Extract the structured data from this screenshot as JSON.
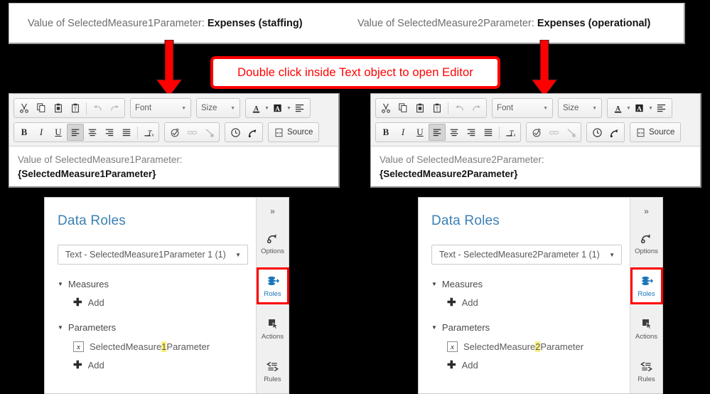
{
  "top_bar": {
    "left": {
      "label": "Value of SelectedMeasure1Parameter:",
      "value": "Expenses (staffing)"
    },
    "right": {
      "label": "Value of SelectedMeasure2Parameter:",
      "value": "Expenses (operational)"
    }
  },
  "callout": {
    "text": "Double click inside Text object to open Editor"
  },
  "editors": [
    {
      "id": "editor-1",
      "toolbar": {
        "cut": "cut-icon",
        "copy": "copy-icon",
        "paste": "paste-icon",
        "paste_text": "paste-as-text-icon",
        "undo": "undo-icon",
        "redo": "redo-icon",
        "font_label": "Font",
        "size_label": "Size",
        "text_color": "text-color-icon",
        "bg_color": "background-color-icon",
        "paragraph_format": "paragraph-format-icon",
        "bold": "B",
        "italic": "I",
        "underline": "U",
        "align_left": "align-left-icon",
        "align_center": "align-center-icon",
        "align_right": "align-right-icon",
        "align_justify": "align-justify-icon",
        "remove_format": "remove-format-icon",
        "spellcheck": "spellcheck-icon",
        "link": "link-icon",
        "unlink": "unlink-icon",
        "datetime": "datetime-icon",
        "branch": "data-item-icon",
        "source_label": "Source"
      },
      "content": {
        "line1": "Value of SelectedMeasure1Parameter:",
        "line2": "{SelectedMeasure1Parameter}"
      }
    },
    {
      "id": "editor-2",
      "toolbar": {
        "cut": "cut-icon",
        "copy": "copy-icon",
        "paste": "paste-icon",
        "paste_text": "paste-as-text-icon",
        "undo": "undo-icon",
        "redo": "redo-icon",
        "font_label": "Font",
        "size_label": "Size",
        "text_color": "text-color-icon",
        "bg_color": "background-color-icon",
        "paragraph_format": "paragraph-format-icon",
        "bold": "B",
        "italic": "I",
        "underline": "U",
        "align_left": "align-left-icon",
        "align_center": "align-center-icon",
        "align_right": "align-right-icon",
        "align_justify": "align-justify-icon",
        "remove_format": "remove-format-icon",
        "spellcheck": "spellcheck-icon",
        "link": "link-icon",
        "unlink": "unlink-icon",
        "datetime": "datetime-icon",
        "branch": "data-item-icon",
        "source_label": "Source"
      },
      "content": {
        "line1": "Value of SelectedMeasure2Parameter:",
        "line2": "{SelectedMeasure2Parameter}"
      }
    }
  ],
  "panels": [
    {
      "id": "panel-1",
      "title": "Data Roles",
      "select_value": "Text - SelectedMeasure1Parameter 1 (1)",
      "groups": [
        {
          "label": "Measures",
          "add_label": "Add"
        },
        {
          "label": "Parameters",
          "add_label": "Add"
        }
      ],
      "parameter": {
        "prefix": "SelectedMeasure",
        "highlight": "1",
        "suffix": "Parameter"
      },
      "rail": {
        "expand": "»",
        "items": [
          {
            "label": "Options",
            "icon": "options-icon",
            "active": false
          },
          {
            "label": "Roles",
            "icon": "roles-icon",
            "active": true
          },
          {
            "label": "Actions",
            "icon": "actions-icon",
            "active": false
          },
          {
            "label": "Rules",
            "icon": "rules-icon",
            "active": false
          }
        ]
      }
    },
    {
      "id": "panel-2",
      "title": "Data Roles",
      "select_value": "Text - SelectedMeasure2Parameter 1 (1)",
      "groups": [
        {
          "label": "Measures",
          "add_label": "Add"
        },
        {
          "label": "Parameters",
          "add_label": "Add"
        }
      ],
      "parameter": {
        "prefix": "SelectedMeasure",
        "highlight": "2",
        "suffix": "Parameter"
      },
      "rail": {
        "expand": "»",
        "items": [
          {
            "label": "Options",
            "icon": "options-icon",
            "active": false
          },
          {
            "label": "Roles",
            "icon": "roles-icon",
            "active": true
          },
          {
            "label": "Actions",
            "icon": "actions-icon",
            "active": false
          },
          {
            "label": "Rules",
            "icon": "rules-icon",
            "active": false
          }
        ]
      }
    }
  ],
  "colors": {
    "background": "#000000",
    "annotation_red": "#ff0000",
    "title_blue": "#3c80b4",
    "highlight_yellow": "#fbf07a",
    "active_rail_label": "#1a74b8"
  }
}
